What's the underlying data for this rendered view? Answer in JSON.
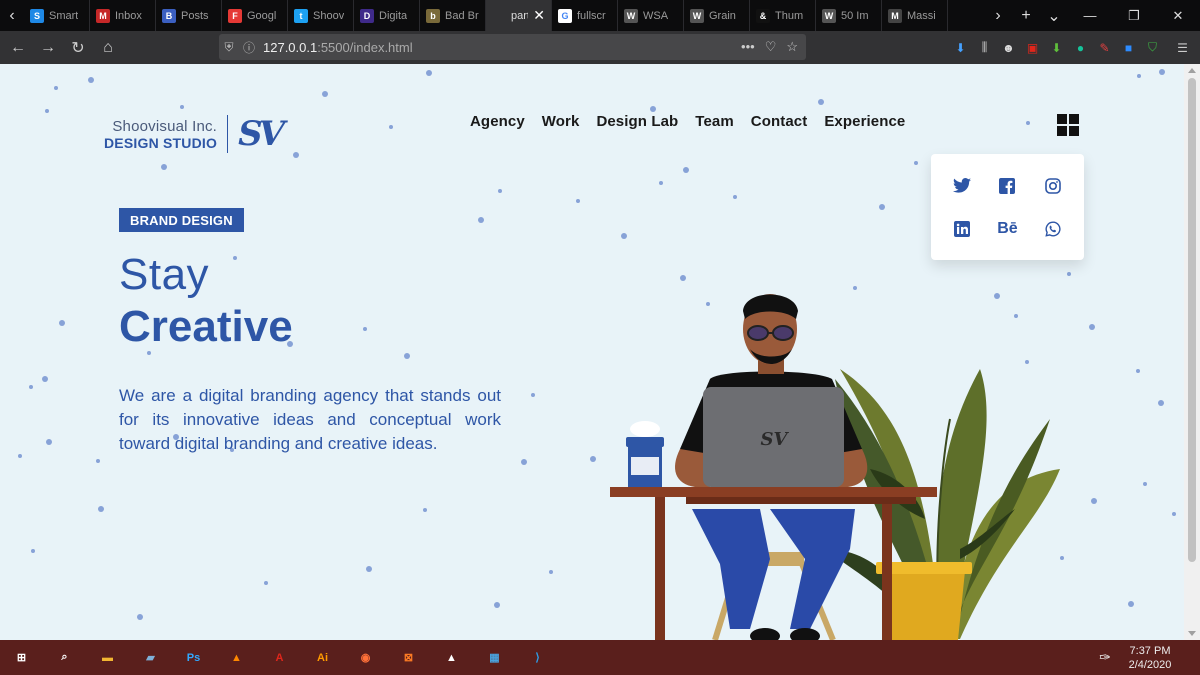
{
  "browser": {
    "tabs": [
      {
        "label": "Smart",
        "fav_color": "#1e88e5",
        "fav_glyph": "S"
      },
      {
        "label": "Inbox",
        "fav_color": "#c62828",
        "fav_glyph": "M"
      },
      {
        "label": "Posts",
        "fav_color": "#3b5fc0",
        "fav_glyph": "B"
      },
      {
        "label": "Googl",
        "fav_color": "#e53935",
        "fav_glyph": "F"
      },
      {
        "label": "Shoov",
        "fav_color": "#1da1f2",
        "fav_glyph": "t"
      },
      {
        "label": "Digita",
        "fav_color": "#3f2a8a",
        "fav_glyph": "D"
      },
      {
        "label": "Bad Br",
        "fav_color": "#7a6a3a",
        "fav_glyph": "b"
      },
      {
        "label": "particle",
        "fav_color": "#323234",
        "fav_glyph": "",
        "active": true
      },
      {
        "label": "fullscr",
        "fav_color": "#ffffff",
        "fav_glyph": "G"
      },
      {
        "label": "WSA",
        "fav_color": "#555555",
        "fav_glyph": "W"
      },
      {
        "label": "Grain",
        "fav_color": "#555555",
        "fav_glyph": "W"
      },
      {
        "label": "Thum",
        "fav_color": "#111111",
        "fav_glyph": "&"
      },
      {
        "label": "50 Im",
        "fav_color": "#555555",
        "fav_glyph": "W"
      },
      {
        "label": "Massi",
        "fav_color": "#444444",
        "fav_glyph": "M"
      }
    ],
    "url_host": "127.0.0.1",
    "url_path": ":5500/index.html"
  },
  "site": {
    "logo_line1": "Shoovisual Inc.",
    "logo_line2": "DESIGN STUDIO",
    "logo_mark": "SV",
    "menu": [
      "Agency",
      "Work",
      "Design Lab",
      "Team",
      "Contact",
      "Experience"
    ],
    "social": [
      {
        "name": "twitter-icon",
        "glyph": "🐦"
      },
      {
        "name": "facebook-icon",
        "glyph": "f"
      },
      {
        "name": "instagram-icon",
        "glyph": "◎"
      },
      {
        "name": "linkedin-icon",
        "glyph": "in"
      },
      {
        "name": "behance-icon",
        "glyph": "Bē"
      },
      {
        "name": "whatsapp-icon",
        "glyph": "✆"
      }
    ],
    "badge": "BRAND DESIGN",
    "headline_light": "Stay",
    "headline_bold": "Creative",
    "lead": "We are a digital branding agency that stands out for its innovative ideas and conceptual work toward digital branding and creative ideas.",
    "laptop_mark": "SV"
  },
  "taskbar": {
    "apps": [
      {
        "name": "windows-start-icon",
        "color": "#ffffff",
        "glyph": "⊞"
      },
      {
        "name": "search-icon",
        "color": "#ffffff",
        "glyph": "⌕"
      },
      {
        "name": "file-explorer-icon",
        "color": "#f2b632",
        "glyph": "▬"
      },
      {
        "name": "notepad-icon",
        "color": "#7fb0d8",
        "glyph": "▰"
      },
      {
        "name": "photoshop-icon",
        "color": "#31a8ff",
        "glyph": "Ps"
      },
      {
        "name": "vlc-icon",
        "color": "#ff8800",
        "glyph": "▲"
      },
      {
        "name": "acrobat-icon",
        "color": "#e0261b",
        "glyph": "A"
      },
      {
        "name": "illustrator-icon",
        "color": "#ff9a00",
        "glyph": "Ai"
      },
      {
        "name": "firefox-icon",
        "color": "#ff7139",
        "glyph": "◉"
      },
      {
        "name": "xampp-icon",
        "color": "#fb7a24",
        "glyph": "⊠"
      },
      {
        "name": "photos-icon",
        "color": "#ffffff",
        "glyph": "▲"
      },
      {
        "name": "control-panel-icon",
        "color": "#4aa3df",
        "glyph": "▦"
      },
      {
        "name": "vscode-icon",
        "color": "#2f9ce6",
        "glyph": "⟩"
      }
    ],
    "time": "7:37 PM",
    "date": "2/4/2020"
  }
}
